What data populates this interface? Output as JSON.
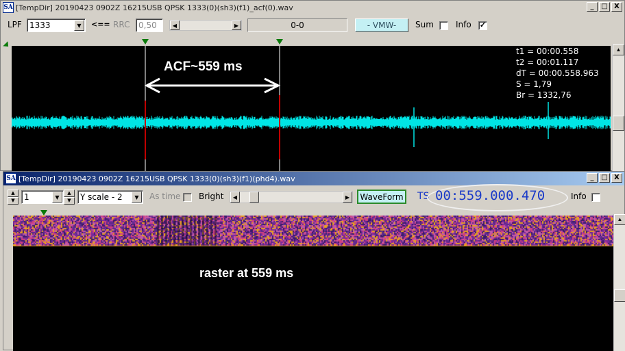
{
  "top_window": {
    "title": "[TempDir] 20190423 0902Z 16215USB QPSK 1333(0)(sh3)(f1)_acf(0).wav",
    "app_icon": "SA",
    "window_buttons": [
      "_",
      "□",
      "X"
    ],
    "toolbar": {
      "lpf_label": "LPF",
      "lpf_value": "1333",
      "arrow_label": "<==",
      "rrc_label": "RRC",
      "rrc_value": "0,50",
      "range_display": "0-0",
      "vmw_button": "- VMW-",
      "sum_label": "Sum",
      "sum_checked": false,
      "info_label": "Info",
      "info_checked": true
    },
    "plot": {
      "annotation": "ACF~559 ms",
      "info_lines": [
        "t1 = 00:00.558",
        "t2 = 00:01.117",
        "dT = 00:00.558.963",
        "S = 1,79",
        "Br = 1332,76"
      ],
      "trace_color": "#00e5e5",
      "cursor_color": "#ffffff",
      "marker_color": "#0a7a0a"
    }
  },
  "bottom_window": {
    "title": "[TempDir] 20190423 0902Z 16215USB QPSK 1333(0)(sh3)(f1)(phd4).wav",
    "app_icon": "SA",
    "window_buttons": [
      "_",
      "□",
      "X"
    ],
    "toolbar": {
      "spin_value": "1",
      "yscale_value": "Y scale - 2",
      "as_time_label": "As time",
      "bright_label": "Bright",
      "waveform_button": "WaveForm",
      "ts_label": "TS",
      "ts_value": "00:559.000.470",
      "info_label": "Info",
      "info_checked": false
    },
    "plot": {
      "annotation": "raster at 559 ms",
      "raster_colors": [
        "#7a2a9a",
        "#c05aa8",
        "#e8a020",
        "#3a1a6a",
        "#5a2a8a",
        "#d04080"
      ]
    }
  }
}
